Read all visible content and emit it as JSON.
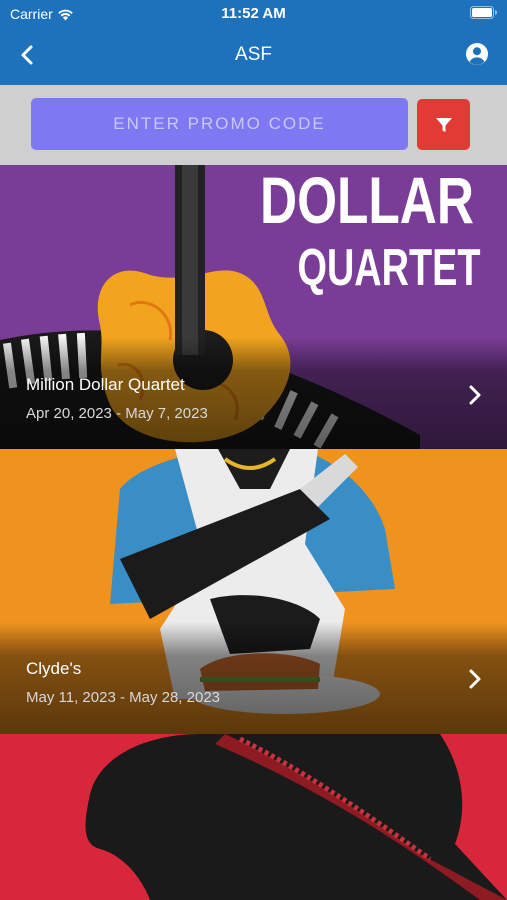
{
  "status_bar": {
    "carrier": "Carrier",
    "time": "11:52 AM"
  },
  "nav": {
    "title": "ASF",
    "back_icon": "chevron-left-icon",
    "account_icon": "user-circle-icon"
  },
  "promo": {
    "placeholder": "ENTER PROMO CODE",
    "filter_icon": "funnel-icon"
  },
  "shows": [
    {
      "title": "Million Dollar Quartet",
      "dates": "Apr 20, 2023 - May 7, 2023",
      "poster_text_line1": "DOLLAR",
      "poster_text_line2": "QUARTET",
      "background": "#7a3d97"
    },
    {
      "title": "Clyde's",
      "dates": "May 11, 2023 - May 28, 2023",
      "background": "#f0921e"
    },
    {
      "background": "#d8263a"
    }
  ],
  "colors": {
    "nav_blue": "#1e72bb",
    "promo_input": "#7e79f2",
    "filter_button": "#e23b36",
    "promo_bar": "#cfcfcf"
  }
}
